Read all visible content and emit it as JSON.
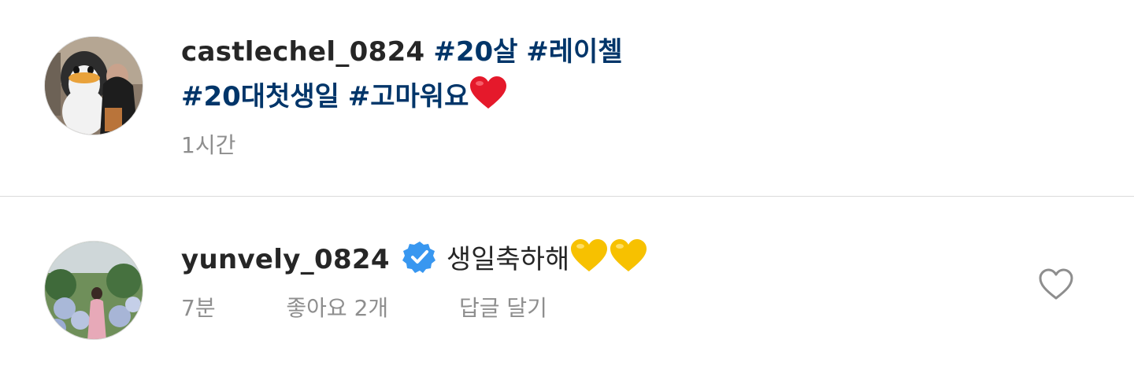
{
  "post_caption": {
    "username": "castlechel_0824",
    "hashtags_line1": [
      "#20살",
      "#레이첼"
    ],
    "hashtags_line2": [
      "#20대첫생일",
      "#고마워요"
    ],
    "emoji": "red-heart",
    "time": "1시간"
  },
  "comment": {
    "username": "yunvely_0824",
    "verified": true,
    "text": "생일축하해",
    "emojis": [
      "yellow-heart",
      "yellow-heart"
    ],
    "time": "7분",
    "likes": "좋아요 2개",
    "reply_label": "답글 달기"
  },
  "colors": {
    "hashtag": "#003569",
    "meta": "#8e8e8e",
    "verified_blue": "#3897f0",
    "divider": "#dbdbdb"
  }
}
